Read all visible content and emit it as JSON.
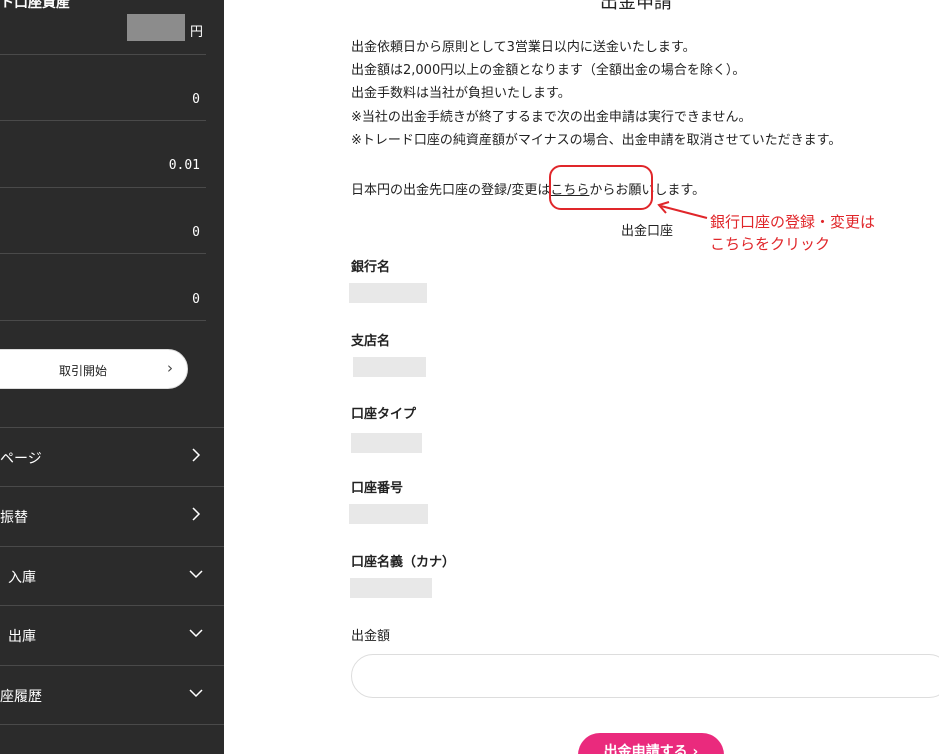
{
  "sidebar": {
    "title": "ト口座資産",
    "balance_unit": "円",
    "rows": [
      {
        "value": "0"
      },
      {
        "value": "0.01"
      },
      {
        "value": "0"
      },
      {
        "value": "0"
      }
    ],
    "trade_button_label": "取引開始",
    "nav": [
      {
        "label": "ページ",
        "icon": "chevron-right-icon"
      },
      {
        "label": "振替",
        "icon": "chevron-right-icon"
      },
      {
        "label": "入庫",
        "icon": "chevron-down-icon"
      },
      {
        "label": "出庫",
        "icon": "chevron-down-icon"
      },
      {
        "label": "座履歴",
        "icon": "chevron-down-icon"
      }
    ]
  },
  "main": {
    "title": "出金申請",
    "notice": [
      "出金依頼日から原則として3営業日以内に送金いたします。",
      "出金額は2,000円以上の金額となります（全額出金の場合を除く）。",
      "出金手数料は当社が負担いたします。",
      "※当社の出金手続きが終了するまで次の出金申請は実行できません。",
      "※トレード口座の純資産額がマイナスの場合、出金申請を取消させていただきます。"
    ],
    "register_prefix": "日本円の出金先口座の登録/変更は",
    "register_link": "こちら",
    "register_suffix": "からお願いします。",
    "annotation": {
      "caption": "出金口座",
      "line1": "銀行口座の登録・変更は",
      "line2": "こちらをクリック",
      "color": "#e0262a"
    },
    "fields": [
      {
        "label": "銀行名"
      },
      {
        "label": "支店名"
      },
      {
        "label": "口座タイプ"
      },
      {
        "label": "口座番号"
      },
      {
        "label": "口座名義（カナ）"
      }
    ],
    "amount_label": "出金額",
    "amount_value": "",
    "submit_label": "出金申請する ›",
    "accent_color": "#ea2a7d"
  }
}
